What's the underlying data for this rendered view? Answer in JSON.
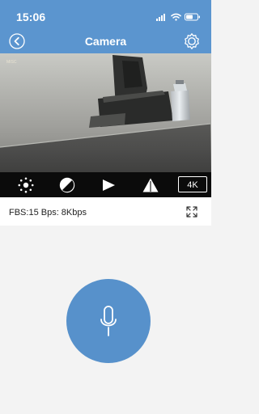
{
  "status_bar": {
    "time": "15:06",
    "icons": [
      "signal-icon",
      "wifi-icon",
      "battery-icon"
    ]
  },
  "header": {
    "title": "Camera",
    "back_icon": "back-icon",
    "settings_icon": "gear-icon"
  },
  "camera_feed": {
    "overlay_text": "MISC"
  },
  "controls": {
    "items": [
      "brightness-icon",
      "contrast-icon",
      "play-icon",
      "warning-icon"
    ],
    "quality_label": "4K"
  },
  "stats": {
    "text": "FBS:15 Bps:  8Kbps"
  },
  "mic": {
    "icon": "microphone-icon"
  },
  "colors": {
    "header_blue": "#5b95cf",
    "mic_blue": "#5791cb",
    "control_bar": "#0b0b0b"
  }
}
